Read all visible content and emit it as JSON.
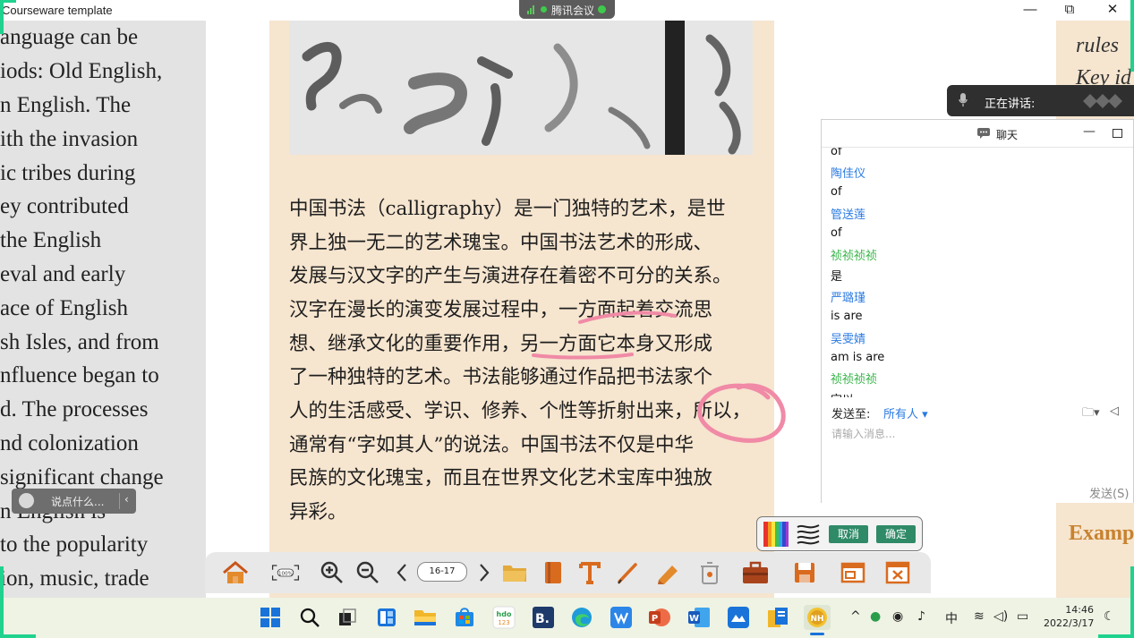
{
  "window": {
    "title": "Courseware template",
    "controls": {
      "minimize": "—",
      "restore": "⧉",
      "close": "✕"
    }
  },
  "meeting": {
    "app_name": "腾讯会议"
  },
  "left_page": {
    "lines": [
      "anguage can be",
      "iods: Old English,",
      "n English. The",
      "ith the invasion",
      "ic tribes during",
      "ey contributed",
      " the English",
      "eval and early",
      "ace of English",
      "sh Isles, and from",
      "nfluence began to",
      "d. The processes",
      "nd colonization",
      "significant change",
      "n English is",
      " to the popularity",
      "ion, music, trade"
    ]
  },
  "center_page": {
    "paragraph_lines": [
      "中国书法（calligraphy）是一门独特的艺术，是世",
      "界上独一无二的艺术瑰宝。中国书法艺术的形成、",
      "发展与汉文字的产生与演进存在着密不可分的关系。",
      "汉字在漫长的演变发展过程中，一方面起着交流思",
      "想、继承文化的重要作用，另一方面它本身又形成",
      "了一种独特的艺术。书法能够通过作品把书法家个",
      "人的生活感受、学识、修养、个性等折射出来，所以，",
      "通常有“字如其人”的说法。中国书法不仅是中华",
      "民族的文化瑰宝，而且在世界文化艺术宝库中独放",
      "异彩。"
    ]
  },
  "right_page": {
    "lines": [
      "rules",
      "Key id"
    ],
    "example_heading": "Examp"
  },
  "speaking": {
    "label": "正在讲话:"
  },
  "chat": {
    "title": "聊天",
    "messages": [
      {
        "kind": "text",
        "text": "of"
      },
      {
        "kind": "name",
        "text": "陶佳仪",
        "color": "#2a7ae2"
      },
      {
        "kind": "text",
        "text": "of"
      },
      {
        "kind": "name",
        "text": "管送莲",
        "color": "#2a7ae2"
      },
      {
        "kind": "text",
        "text": "of"
      },
      {
        "kind": "name",
        "text": "祯祯祯祯",
        "color": "#39b54a"
      },
      {
        "kind": "text",
        "text": "是"
      },
      {
        "kind": "name",
        "text": "严璐瑾",
        "color": "#2a7ae2"
      },
      {
        "kind": "text",
        "text": "is are"
      },
      {
        "kind": "name",
        "text": "吴雯婧",
        "color": "#2a7ae2"
      },
      {
        "kind": "text",
        "text": "am  is  are"
      },
      {
        "kind": "name",
        "text": "祯祯祯祯",
        "color": "#39b54a"
      },
      {
        "kind": "text",
        "text": "定以"
      }
    ],
    "send_to_label": "发送至:",
    "send_to_value": "所有人 ▾",
    "input_placeholder": "请输入消息...",
    "send_button": "发送(S)"
  },
  "toolbar": {
    "page_indicator": "16-17",
    "zoom_reset": "100%",
    "items": [
      "home",
      "fit-page",
      "zoom-in",
      "zoom-out",
      "prev-page",
      "next-page",
      "open-folder",
      "book",
      "text-tool",
      "pen-tool",
      "eraser",
      "clear",
      "briefcase",
      "save",
      "window",
      "close"
    ]
  },
  "picker": {
    "cancel": "取消",
    "confirm": "确定"
  },
  "say_pill": {
    "placeholder": "说点什么..."
  },
  "taskbar": {
    "apps": [
      "start",
      "search",
      "task-view",
      "widgets",
      "file-explorer",
      "store",
      "hdo-123",
      "b-app",
      "edge",
      "vpn-app",
      "powerpoint",
      "word",
      "cloud-app",
      "explorer-doc",
      "nh-app"
    ],
    "hdo_label": "hdo 123",
    "b_label": "B.",
    "ime": "中",
    "time": "14:46",
    "date": "2022/3/17"
  },
  "colors": {
    "page_beige": "#f6e5cf",
    "annotation_pink": "#f08aa6",
    "accent_green": "#2f8a68",
    "chat_blue": "#2a7ae2",
    "chat_green": "#39b54a",
    "share_green": "#20d28e"
  }
}
